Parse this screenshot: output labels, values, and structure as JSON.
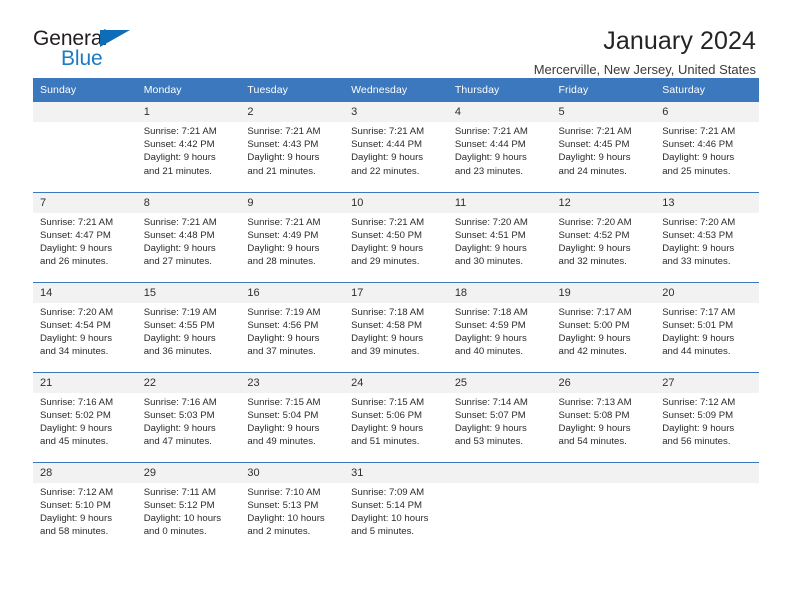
{
  "brand": {
    "name_primary": "General",
    "name_secondary": "Blue",
    "triangle_color": "#0f6cb6",
    "secondary_color": "#1c7bc4"
  },
  "header": {
    "title": "January 2024",
    "subtitle": "Mercerville, New Jersey, United States"
  },
  "theme": {
    "header_bg": "#3b78bd",
    "daynum_bg": "#f2f2f2",
    "grid_line": "#3b78bd",
    "text": "#2b2b2b"
  },
  "weekdays": [
    "Sunday",
    "Monday",
    "Tuesday",
    "Wednesday",
    "Thursday",
    "Friday",
    "Saturday"
  ],
  "weeks": [
    [
      {
        "day": "",
        "details": ""
      },
      {
        "day": "1",
        "details": "Sunrise: 7:21 AM\nSunset: 4:42 PM\nDaylight: 9 hours\nand 21 minutes."
      },
      {
        "day": "2",
        "details": "Sunrise: 7:21 AM\nSunset: 4:43 PM\nDaylight: 9 hours\nand 21 minutes."
      },
      {
        "day": "3",
        "details": "Sunrise: 7:21 AM\nSunset: 4:44 PM\nDaylight: 9 hours\nand 22 minutes."
      },
      {
        "day": "4",
        "details": "Sunrise: 7:21 AM\nSunset: 4:44 PM\nDaylight: 9 hours\nand 23 minutes."
      },
      {
        "day": "5",
        "details": "Sunrise: 7:21 AM\nSunset: 4:45 PM\nDaylight: 9 hours\nand 24 minutes."
      },
      {
        "day": "6",
        "details": "Sunrise: 7:21 AM\nSunset: 4:46 PM\nDaylight: 9 hours\nand 25 minutes."
      }
    ],
    [
      {
        "day": "7",
        "details": "Sunrise: 7:21 AM\nSunset: 4:47 PM\nDaylight: 9 hours\nand 26 minutes."
      },
      {
        "day": "8",
        "details": "Sunrise: 7:21 AM\nSunset: 4:48 PM\nDaylight: 9 hours\nand 27 minutes."
      },
      {
        "day": "9",
        "details": "Sunrise: 7:21 AM\nSunset: 4:49 PM\nDaylight: 9 hours\nand 28 minutes."
      },
      {
        "day": "10",
        "details": "Sunrise: 7:21 AM\nSunset: 4:50 PM\nDaylight: 9 hours\nand 29 minutes."
      },
      {
        "day": "11",
        "details": "Sunrise: 7:20 AM\nSunset: 4:51 PM\nDaylight: 9 hours\nand 30 minutes."
      },
      {
        "day": "12",
        "details": "Sunrise: 7:20 AM\nSunset: 4:52 PM\nDaylight: 9 hours\nand 32 minutes."
      },
      {
        "day": "13",
        "details": "Sunrise: 7:20 AM\nSunset: 4:53 PM\nDaylight: 9 hours\nand 33 minutes."
      }
    ],
    [
      {
        "day": "14",
        "details": "Sunrise: 7:20 AM\nSunset: 4:54 PM\nDaylight: 9 hours\nand 34 minutes."
      },
      {
        "day": "15",
        "details": "Sunrise: 7:19 AM\nSunset: 4:55 PM\nDaylight: 9 hours\nand 36 minutes."
      },
      {
        "day": "16",
        "details": "Sunrise: 7:19 AM\nSunset: 4:56 PM\nDaylight: 9 hours\nand 37 minutes."
      },
      {
        "day": "17",
        "details": "Sunrise: 7:18 AM\nSunset: 4:58 PM\nDaylight: 9 hours\nand 39 minutes."
      },
      {
        "day": "18",
        "details": "Sunrise: 7:18 AM\nSunset: 4:59 PM\nDaylight: 9 hours\nand 40 minutes."
      },
      {
        "day": "19",
        "details": "Sunrise: 7:17 AM\nSunset: 5:00 PM\nDaylight: 9 hours\nand 42 minutes."
      },
      {
        "day": "20",
        "details": "Sunrise: 7:17 AM\nSunset: 5:01 PM\nDaylight: 9 hours\nand 44 minutes."
      }
    ],
    [
      {
        "day": "21",
        "details": "Sunrise: 7:16 AM\nSunset: 5:02 PM\nDaylight: 9 hours\nand 45 minutes."
      },
      {
        "day": "22",
        "details": "Sunrise: 7:16 AM\nSunset: 5:03 PM\nDaylight: 9 hours\nand 47 minutes."
      },
      {
        "day": "23",
        "details": "Sunrise: 7:15 AM\nSunset: 5:04 PM\nDaylight: 9 hours\nand 49 minutes."
      },
      {
        "day": "24",
        "details": "Sunrise: 7:15 AM\nSunset: 5:06 PM\nDaylight: 9 hours\nand 51 minutes."
      },
      {
        "day": "25",
        "details": "Sunrise: 7:14 AM\nSunset: 5:07 PM\nDaylight: 9 hours\nand 53 minutes."
      },
      {
        "day": "26",
        "details": "Sunrise: 7:13 AM\nSunset: 5:08 PM\nDaylight: 9 hours\nand 54 minutes."
      },
      {
        "day": "27",
        "details": "Sunrise: 7:12 AM\nSunset: 5:09 PM\nDaylight: 9 hours\nand 56 minutes."
      }
    ],
    [
      {
        "day": "28",
        "details": "Sunrise: 7:12 AM\nSunset: 5:10 PM\nDaylight: 9 hours\nand 58 minutes."
      },
      {
        "day": "29",
        "details": "Sunrise: 7:11 AM\nSunset: 5:12 PM\nDaylight: 10 hours\nand 0 minutes."
      },
      {
        "day": "30",
        "details": "Sunrise: 7:10 AM\nSunset: 5:13 PM\nDaylight: 10 hours\nand 2 minutes."
      },
      {
        "day": "31",
        "details": "Sunrise: 7:09 AM\nSunset: 5:14 PM\nDaylight: 10 hours\nand 5 minutes."
      },
      {
        "day": "",
        "details": ""
      },
      {
        "day": "",
        "details": ""
      },
      {
        "day": "",
        "details": ""
      }
    ]
  ]
}
